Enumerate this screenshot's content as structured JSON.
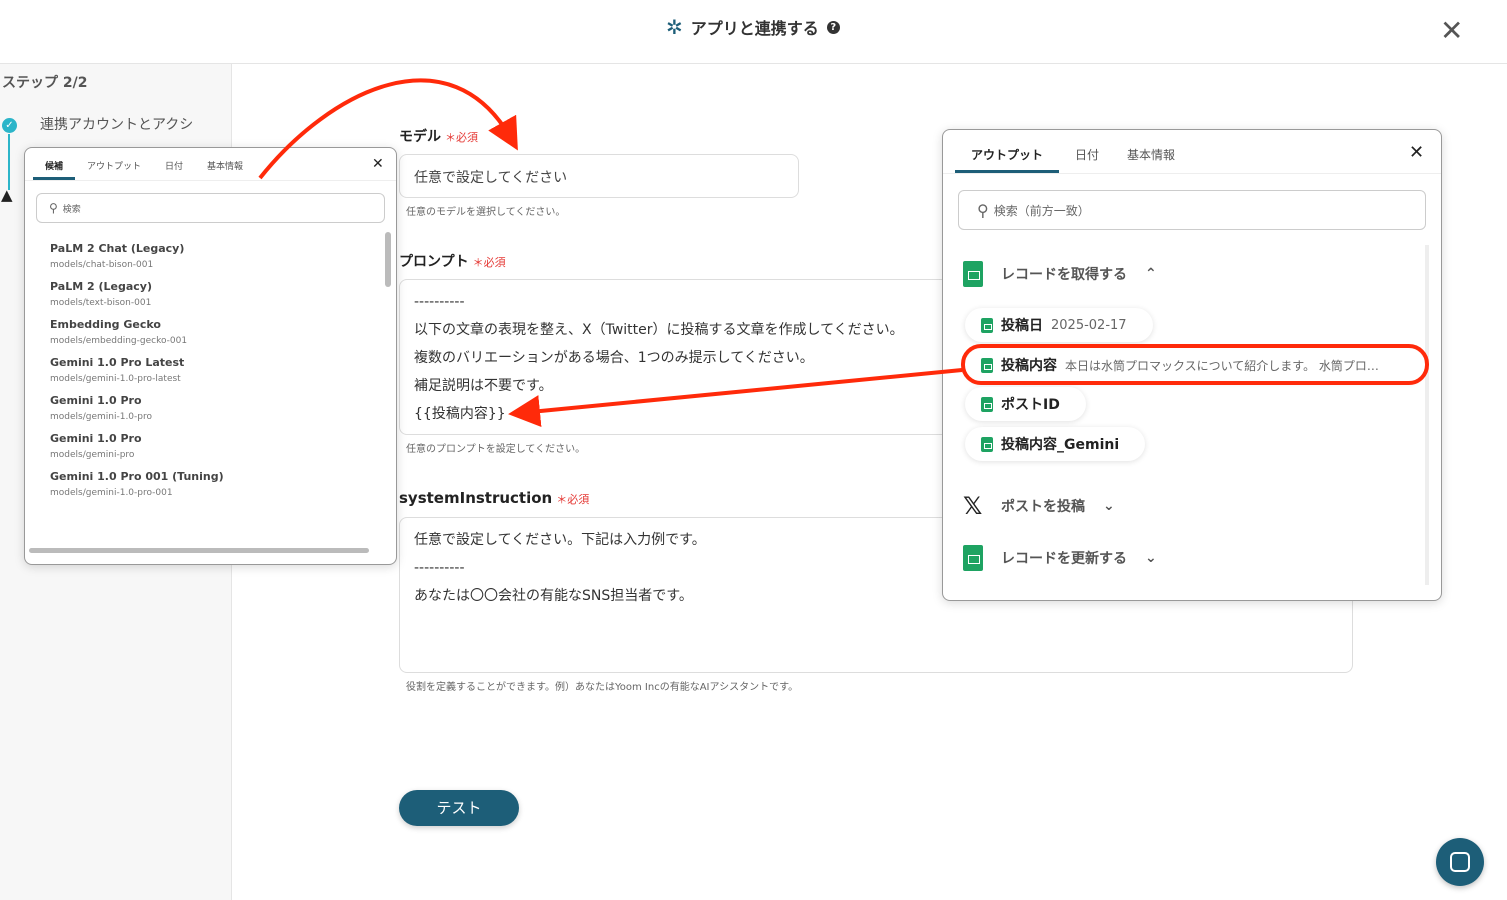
{
  "header": {
    "title": "アプリと連携する",
    "help": "?",
    "close": "✕"
  },
  "sidebar": {
    "step": "ステップ 2/2",
    "item": "連携アカウントとアクシ",
    "check": "✓",
    "warn": "▲"
  },
  "form": {
    "model": {
      "label": "モデル",
      "required": "＊必須",
      "placeholder": "任意で設定してください",
      "hint": "任意のモデルを選択してください。"
    },
    "prompt": {
      "label": "プロンプト",
      "required": "＊必須",
      "lines": [
        "----------",
        "以下の文章の表現を整え、X（Twitter）に投稿する文章を作成してください。",
        "複数のバリエーションがある場合、1つのみ提示してください。",
        "補足説明は不要です。",
        "{{投稿内容}}"
      ],
      "hint": "任意のプロンプトを設定してください。"
    },
    "system": {
      "label": "systemInstruction",
      "required": "＊必須",
      "lines": [
        "任意で設定してください。下記は入力例です。",
        "----------",
        "あなたは〇〇会社の有能なSNS担当者です。"
      ],
      "hint": "役割を定義することができます。例）あなたはYoom Incの有能なAIアシスタントです。"
    },
    "test_button": "テスト"
  },
  "left_popup": {
    "tabs": [
      "候補",
      "アウトプット",
      "日付",
      "基本情報"
    ],
    "search_placeholder": "検索",
    "close": "✕",
    "models": [
      {
        "name": "PaLM 2 Chat (Legacy)",
        "id": "models/chat-bison-001"
      },
      {
        "name": "PaLM 2 (Legacy)",
        "id": "models/text-bison-001"
      },
      {
        "name": "Embedding Gecko",
        "id": "models/embedding-gecko-001"
      },
      {
        "name": "Gemini 1.0 Pro Latest",
        "id": "models/gemini-1.0-pro-latest"
      },
      {
        "name": "Gemini 1.0 Pro",
        "id": "models/gemini-1.0-pro"
      },
      {
        "name": "Gemini 1.0 Pro",
        "id": "models/gemini-pro"
      },
      {
        "name": "Gemini 1.0 Pro 001 (Tuning)",
        "id": "models/gemini-1.0-pro-001"
      }
    ]
  },
  "right_popup": {
    "tabs": [
      "アウトプット",
      "日付",
      "基本情報"
    ],
    "search_placeholder": "検索（前方一致）",
    "close": "✕",
    "group1": {
      "label": "レコードを取得する",
      "chevron": "⌃"
    },
    "items": [
      {
        "name": "投稿日",
        "value": "2025-02-17"
      },
      {
        "name": "投稿内容",
        "value": "本日は水筒プロマックスについて紹介します。 水筒プロ…"
      },
      {
        "name": "ポストID",
        "value": ""
      },
      {
        "name": "投稿内容_Gemini",
        "value": ""
      }
    ],
    "group2": {
      "label": "ポストを投稿",
      "chevron": "⌄",
      "icon": "𝕏"
    },
    "group3": {
      "label": "レコードを更新する",
      "chevron": "⌄"
    }
  },
  "colors": {
    "accent": "#1d5e78",
    "required": "#e53935",
    "annotation": "#ff2a0a",
    "sheets": "#1ea362"
  }
}
